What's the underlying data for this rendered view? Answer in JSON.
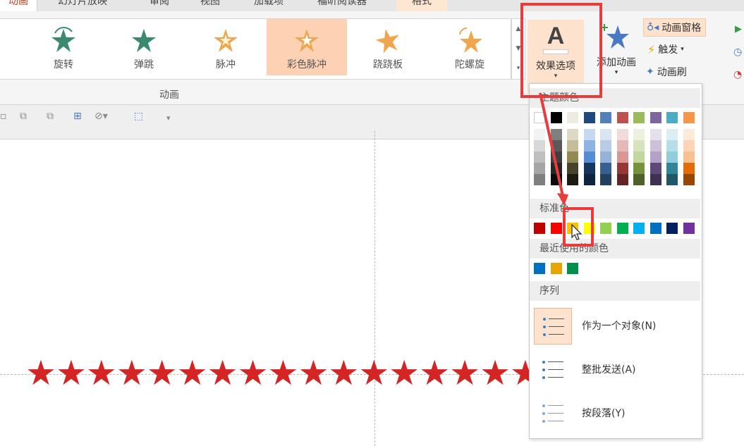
{
  "tabs": [
    "动画",
    "幻灯片放映",
    "审阅",
    "视图",
    "加载项",
    "福昕阅读器",
    "格式"
  ],
  "gallery": {
    "effects": [
      {
        "label": "旋转",
        "icon": "star-rotate-icon",
        "color": "#3a8a6e",
        "selected": false
      },
      {
        "label": "弹跳",
        "icon": "star-bounce-icon",
        "color": "#3a8a6e",
        "selected": false
      },
      {
        "label": "脉冲",
        "icon": "star-pulse-icon",
        "color": "#f0a64e",
        "selected": false
      },
      {
        "label": "彩色脉冲",
        "icon": "star-color-pulse-icon",
        "color": "#f0a64e",
        "selected": true
      },
      {
        "label": "跷跷板",
        "icon": "star-teeter-icon",
        "color": "#f0a64e",
        "selected": false
      },
      {
        "label": "陀螺旋",
        "icon": "star-spin-icon",
        "color": "#f0a64e",
        "selected": false
      }
    ],
    "group_label": "动画"
  },
  "effect_options": {
    "glyph": "A",
    "label": "效果选项",
    "dropdown": "▾"
  },
  "add_animation": {
    "label": "添加动画",
    "dropdown": "▾"
  },
  "advanced": {
    "animation_pane": "动画窗格",
    "trigger": "触发",
    "trigger_dd": "▾",
    "painter": "动画刷"
  },
  "dropdown": {
    "theme_colors_label": "主题颜色",
    "theme_top": [
      "#ffffff",
      "#000000",
      "#eeece1",
      "#1f497d",
      "#4f81bd",
      "#c0504d",
      "#9bbb59",
      "#8064a2",
      "#4bacc6",
      "#f79646"
    ],
    "theme_shades": [
      [
        "#f2f2f2",
        "#d8d8d8",
        "#bfbfbf",
        "#a5a5a5",
        "#7f7f7f"
      ],
      [
        "#7f7f7f",
        "#595959",
        "#3f3f3f",
        "#262626",
        "#0c0c0c"
      ],
      [
        "#ddd9c3",
        "#c4bd97",
        "#938953",
        "#494429",
        "#1d1b10"
      ],
      [
        "#c6d9f0",
        "#8db3e2",
        "#548dd4",
        "#17365d",
        "#0f243e"
      ],
      [
        "#dbe5f1",
        "#b8cce4",
        "#95b3d7",
        "#366092",
        "#244061"
      ],
      [
        "#f2dcdb",
        "#e5b9b7",
        "#d99694",
        "#953734",
        "#632423"
      ],
      [
        "#ebf1dd",
        "#d7e3bc",
        "#c3d69b",
        "#76923c",
        "#4f6128"
      ],
      [
        "#e5e0ec",
        "#ccc1d9",
        "#b2a2c7",
        "#5f497a",
        "#3f3151"
      ],
      [
        "#dbeef3",
        "#b7dde8",
        "#92cddc",
        "#31859b",
        "#205867"
      ],
      [
        "#fdeada",
        "#fbd5b5",
        "#fac08f",
        "#e36c09",
        "#974806"
      ]
    ],
    "standard_label": "标准色",
    "standard_colors": [
      "#c00000",
      "#ff0000",
      "#ffc000",
      "#ffff00",
      "#92d050",
      "#00b050",
      "#00b0f0",
      "#0070c0",
      "#002060",
      "#7030a0"
    ],
    "recent_label": "最近使用的颜色",
    "recent_colors": [
      "#0070c0",
      "#e6a400",
      "#00904a"
    ],
    "sequence_label": "序列",
    "sequence": [
      {
        "label": "作为一个对象(N)",
        "selected": true
      },
      {
        "label": "整批发送(A)",
        "selected": false
      },
      {
        "label": "按段落(Y)",
        "selected": false
      }
    ]
  },
  "slide": {
    "star_count": 20,
    "star_glyph": "★",
    "star_color": "#d42424"
  },
  "colors": {
    "selection_fill": "#fde2cd",
    "highlight_border": "#e83c3c"
  }
}
